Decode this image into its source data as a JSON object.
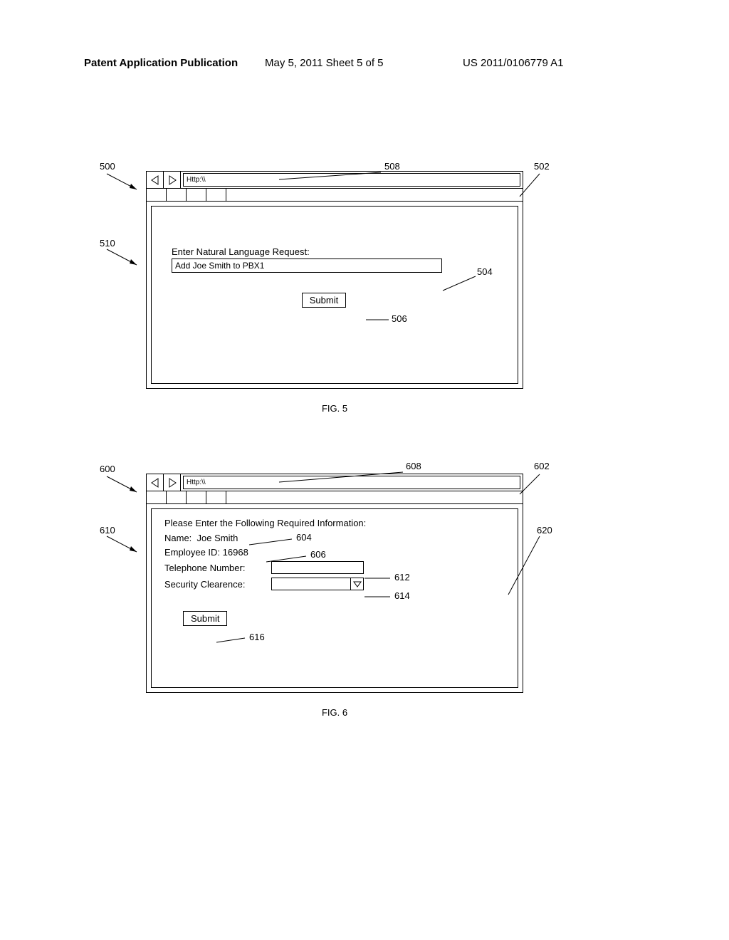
{
  "header": {
    "left": "Patent Application Publication",
    "mid": "May 5, 2011  Sheet 5 of 5",
    "right": "US 2011/0106779 A1"
  },
  "fig5": {
    "url": "Http:\\\\",
    "prompt": "Enter Natural Language Request:",
    "input_value": "Add Joe Smith to PBX1",
    "submit": "Submit",
    "caption": "FIG. 5",
    "refs": {
      "r500": "500",
      "r502": "502",
      "r504": "504",
      "r506": "506",
      "r508": "508",
      "r510": "510"
    }
  },
  "fig6": {
    "url": "Http:\\\\",
    "heading": "Please Enter the Following Required Information:",
    "name_label": "Name:",
    "name_value": "Joe Smith",
    "emp_label": "Employee ID:",
    "emp_value": "16968",
    "tel_label": "Telephone Number:",
    "sec_label": "Security Clearence:",
    "submit": "Submit",
    "caption": "FIG. 6",
    "refs": {
      "r600": "600",
      "r602": "602",
      "r604": "604",
      "r606": "606",
      "r608": "608",
      "r610": "610",
      "r612": "612",
      "r614": "614",
      "r616": "616",
      "r620": "620"
    }
  }
}
